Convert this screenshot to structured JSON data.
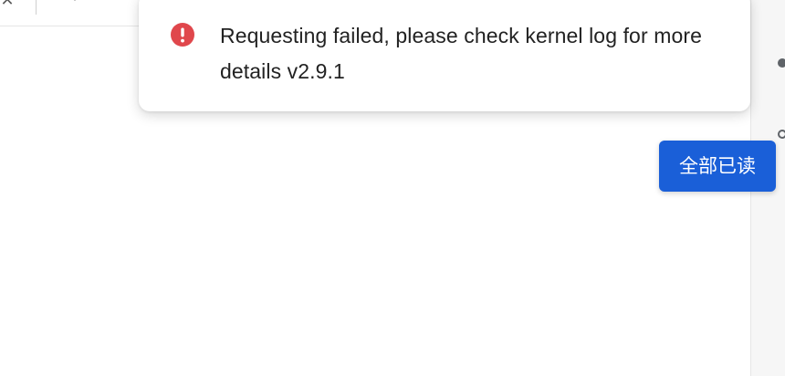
{
  "toast": {
    "message": "Requesting failed, please check kernel log for more details v2.9.1",
    "icon": "error-icon",
    "icon_color": "#e0474c"
  },
  "actions": {
    "mark_all_read_label": "全部已读",
    "button_color": "#1a5fd8"
  },
  "tabstrip": {
    "close_glyph": "✕",
    "add_glyph": "+"
  }
}
